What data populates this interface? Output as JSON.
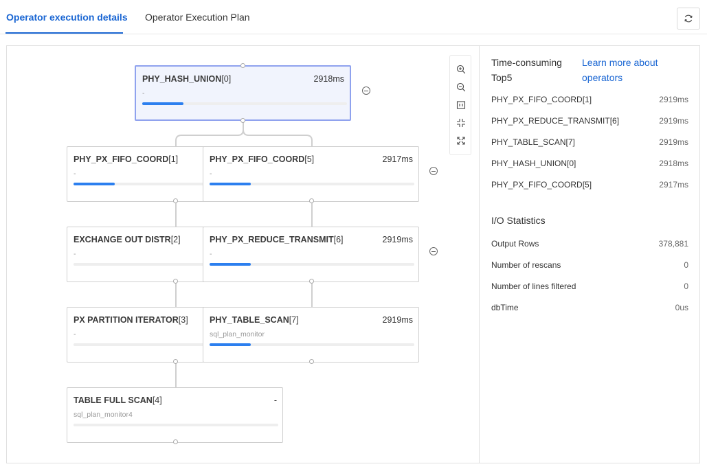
{
  "tabs": [
    {
      "label": "Operator execution details",
      "active": true
    },
    {
      "label": "Operator Execution Plan",
      "active": false
    }
  ],
  "icons": {
    "refresh": "refresh-icon",
    "zoom_in": "zoom-in-icon",
    "zoom_out": "zoom-out-icon",
    "fit": "fit-view-icon",
    "shrink": "collapse-arrows-icon",
    "expand": "expand-arrows-icon",
    "collapse": "minus-circle-icon"
  },
  "nodes": [
    {
      "name": "PHY_HASH_UNION",
      "idx": "[0]",
      "time": "2918ms",
      "sub": "-",
      "progress": 0.2
    },
    {
      "name": "PHY_PX_FIFO_COORD",
      "idx": "[1]",
      "time": "",
      "sub": "-",
      "progress": 0.2
    },
    {
      "name": "PHY_PX_FIFO_COORD",
      "idx": "[5]",
      "time": "2917ms",
      "sub": "-",
      "progress": 0.2
    },
    {
      "name": "EXCHANGE OUT DISTR",
      "idx": "[2]",
      "time": "",
      "sub": "-",
      "progress": 0
    },
    {
      "name": "PHY_PX_REDUCE_TRANSMIT",
      "idx": "[6]",
      "time": "2919ms",
      "sub": "-",
      "progress": 0.2
    },
    {
      "name": "PX PARTITION ITERATOR",
      "idx": "[3]",
      "time": "",
      "sub": "-",
      "progress": 0
    },
    {
      "name": "PHY_TABLE_SCAN",
      "idx": "[7]",
      "time": "2919ms",
      "sub": "sql_plan_monitor",
      "progress": 0.2
    },
    {
      "name": "TABLE FULL SCAN",
      "idx": "[4]",
      "time": "-",
      "sub": "sql_plan_monitor4",
      "progress": 0
    }
  ],
  "side": {
    "title": "Time-consuming Top5",
    "link": "Learn more about operators",
    "top5": [
      {
        "name": "PHY_PX_FIFO_COORD[1]",
        "value": "2919ms"
      },
      {
        "name": "PHY_PX_REDUCE_TRANSMIT[6]",
        "value": "2919ms"
      },
      {
        "name": "PHY_TABLE_SCAN[7]",
        "value": "2919ms"
      },
      {
        "name": "PHY_HASH_UNION[0]",
        "value": "2918ms"
      },
      {
        "name": "PHY_PX_FIFO_COORD[5]",
        "value": "2917ms"
      }
    ],
    "io_title": "I/O Statistics",
    "io": [
      {
        "name": "Output Rows",
        "value": "378,881"
      },
      {
        "name": "Number of rescans",
        "value": "0"
      },
      {
        "name": "Number of lines filtered",
        "value": "0"
      },
      {
        "name": "dbTime",
        "value": "0us"
      }
    ]
  },
  "colors": {
    "accent": "#1a66d3",
    "progress": "#2c7fef",
    "selected_bg": "#f1f4fd",
    "selected_border": "#8fa2ee"
  }
}
